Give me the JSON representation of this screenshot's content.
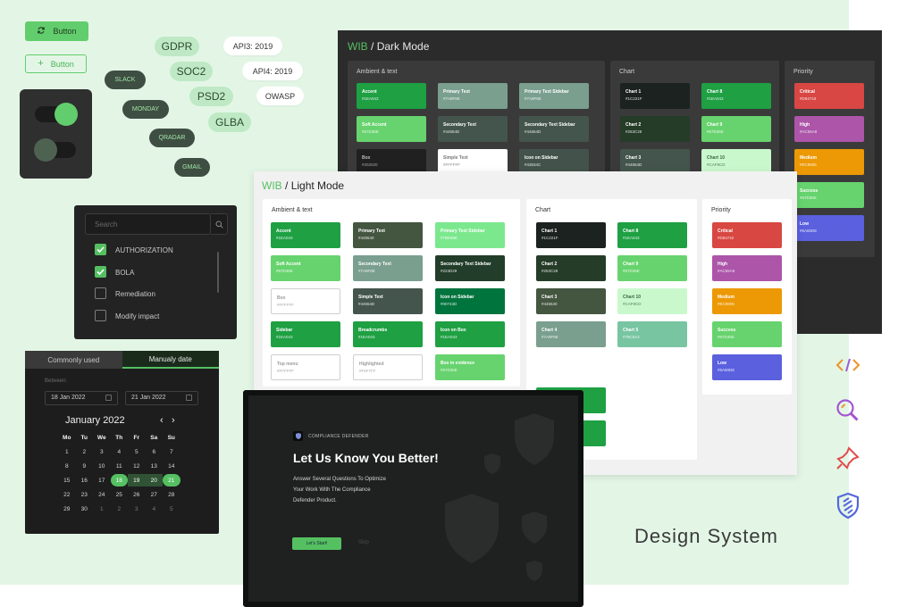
{
  "buttons": {
    "primary_label": "Button",
    "secondary_label": "Button"
  },
  "toggles": {
    "top_state": "on",
    "bottom_state": "off"
  },
  "tags": {
    "gdpr": "GDPR",
    "soc2": "SOC2",
    "psd2": "PSD2",
    "glba": "GLBA",
    "slack": "SLACK",
    "monday": "MONDAY",
    "qradar": "QRADAR",
    "gmail": "GMAIL",
    "api3": "API3: 2019",
    "api4": "API4: 2019",
    "owasp": "OWASP"
  },
  "filter": {
    "search_placeholder": "Search",
    "items": [
      {
        "label": "AUTHORIZATION",
        "checked": true
      },
      {
        "label": "BOLA",
        "checked": true
      },
      {
        "label": "Remediation",
        "checked": false
      },
      {
        "label": "Modify impact",
        "checked": false
      }
    ]
  },
  "date_picker": {
    "tab_common": "Commonly used",
    "tab_manual": "Manualy date",
    "between_label": "Between:",
    "start_date": "18 Jan 2022",
    "end_date": "21 Jan 2022",
    "month": "January 2022",
    "weekdays": [
      "Mo",
      "Tu",
      "We",
      "Th",
      "Fr",
      "Sa",
      "Su"
    ],
    "weeks": [
      [
        "1",
        "2",
        "3",
        "4",
        "5",
        "6",
        "7"
      ],
      [
        "8",
        "9",
        "10",
        "11",
        "12",
        "13",
        "14"
      ],
      [
        "15",
        "16",
        "17",
        "18",
        "19",
        "20",
        "21"
      ],
      [
        "22",
        "23",
        "24",
        "25",
        "26",
        "27",
        "28"
      ],
      [
        "29",
        "30",
        "1",
        "2",
        "3",
        "4",
        "5"
      ]
    ],
    "range_start": "18",
    "range_end": "21"
  },
  "dark_mode": {
    "brand": "WIB",
    "sep": " / ",
    "title": "Dark Mode",
    "ambient_header": "Ambient & text",
    "chart_header": "Chart",
    "priority_header": "Priority",
    "ambient": [
      {
        "name": "Accent",
        "hex": "#1EA043",
        "color": "#1ea043",
        "fg": "#ffffff"
      },
      {
        "name": "Primary Text",
        "hex": "#7A9F8E",
        "color": "#7a9f8e",
        "fg": "#ffffff"
      },
      {
        "name": "Primary Text Sidebar",
        "hex": "#7A9F8E",
        "color": "#7a9f8e",
        "fg": "#ffffff"
      },
      {
        "name": "Soft Accent",
        "hex": "#67D36E",
        "color": "#67d36e",
        "fg": "#ffffff"
      },
      {
        "name": "Secondary Text",
        "hex": "#44554D",
        "color": "#44554d",
        "fg": "#ffffff"
      },
      {
        "name": "Secondary Text Sidebar",
        "hex": "#44554D",
        "color": "#44554d",
        "fg": "#ffffff"
      },
      {
        "name": "Box",
        "hex": "#202020",
        "color": "#202020",
        "fg": "#bdbdbd"
      },
      {
        "name": "Simple Text",
        "hex": "#FFFFFF",
        "color": "#ffffff",
        "fg": "#777777"
      },
      {
        "name": "Icon on Sidebar",
        "hex": "#43534C",
        "color": "#43534c",
        "fg": "#ffffff"
      }
    ],
    "chart": [
      {
        "name": "Chart 1",
        "hex": "#1C221F",
        "color": "#1c221f",
        "fg": "#ffffff"
      },
      {
        "name": "Chart 8",
        "hex": "#1EA043",
        "color": "#1ea043",
        "fg": "#ffffff"
      },
      {
        "name": "Chart 2",
        "hex": "#253C28",
        "color": "#253c28",
        "fg": "#ffffff"
      },
      {
        "name": "Chart 9",
        "hex": "#67D36E",
        "color": "#67d36e",
        "fg": "#ffffff"
      },
      {
        "name": "Chart 3",
        "hex": "#44554D",
        "color": "#44554d",
        "fg": "#ffffff"
      },
      {
        "name": "Chart 10",
        "hex": "#CAF8CD",
        "color": "#caf8cd",
        "fg": "#3a6a40"
      }
    ],
    "priority": [
      {
        "name": "Critical",
        "hex": "#D84743",
        "color": "#d84743",
        "fg": "#ffffff"
      },
      {
        "name": "High",
        "hex": "#AC55A9",
        "color": "#ac55a9",
        "fg": "#ffffff"
      },
      {
        "name": "Medium",
        "hex": "#EC9905",
        "color": "#ec9905",
        "fg": "#ffffff"
      },
      {
        "name": "Success",
        "hex": "#67D36E",
        "color": "#67d36e",
        "fg": "#ffffff"
      },
      {
        "name": "Low",
        "hex": "#5A60DE",
        "color": "#5a60de",
        "fg": "#ffffff"
      }
    ]
  },
  "light_mode": {
    "brand": "WIB",
    "sep": " / ",
    "title": "Light Mode",
    "ambient_header": "Ambient & text",
    "chart_header": "Chart",
    "priority_header": "Priority",
    "ambient": [
      {
        "name": "Accent",
        "hex": "#1EA043",
        "color": "#1ea043",
        "fg": "#ffffff"
      },
      {
        "name": "Primary Text",
        "hex": "#445540",
        "color": "#445540",
        "fg": "#ffffff"
      },
      {
        "name": "Primary Text Sidebar",
        "hex": "#7BE88E",
        "color": "#7be88e",
        "fg": "#ffffff"
      },
      {
        "name": "Soft Accent",
        "hex": "#67D36E",
        "color": "#67d36e",
        "fg": "#ffffff"
      },
      {
        "name": "Secondary Text",
        "hex": "#7A9F8E",
        "color": "#7a9f8e",
        "fg": "#ffffff"
      },
      {
        "name": "Secondary Text Sidebar",
        "hex": "#223D29",
        "color": "#223d29",
        "fg": "#ffffff"
      },
      {
        "name": "Box",
        "hex": "#FFFFFF",
        "color": "#ffffff",
        "fg": "#9a9a9a",
        "border": "#cfcfcf"
      },
      {
        "name": "Simple Text",
        "hex": "#44554D",
        "color": "#44554d",
        "fg": "#ffffff"
      },
      {
        "name": "Icon on Sidebar",
        "hex": "#00743D",
        "color": "#00743d",
        "fg": "#ffffff"
      },
      {
        "name": "Sidebar",
        "hex": "#1EA043",
        "color": "#1ea043",
        "fg": "#ffffff"
      },
      {
        "name": "Breadcrumbs",
        "hex": "#1EA043",
        "color": "#1ea043",
        "fg": "#ffffff"
      },
      {
        "name": "Icon on Box",
        "hex": "#1EA043",
        "color": "#1ea043",
        "fg": "#ffffff"
      },
      {
        "name": "Top menu",
        "hex": "#FFFFFF",
        "color": "#ffffff",
        "fg": "#9a9a9a",
        "border": "#cfcfcf"
      },
      {
        "name": "Highlighted",
        "hex": "#F6F7FF",
        "color": "#ffffff",
        "fg": "#9a9a9a",
        "border": "#cfcfcf"
      },
      {
        "name": "Box in evidence",
        "hex": "#67D36E",
        "color": "#67d36e",
        "fg": "#ffffff"
      }
    ],
    "chart": [
      {
        "name": "Chart 1",
        "hex": "#1C221F",
        "color": "#1c221f",
        "fg": "#ffffff"
      },
      {
        "name": "Chart 8",
        "hex": "#1EA043",
        "color": "#1ea043",
        "fg": "#ffffff"
      },
      {
        "name": "Chart 2",
        "hex": "#253C28",
        "color": "#253c28",
        "fg": "#ffffff"
      },
      {
        "name": "Chart 9",
        "hex": "#67D36E",
        "color": "#67d36e",
        "fg": "#ffffff"
      },
      {
        "name": "Chart 3",
        "hex": "#445540",
        "color": "#445540",
        "fg": "#ffffff"
      },
      {
        "name": "Chart 10",
        "hex": "#CAF8CD",
        "color": "#caf8cd",
        "fg": "#3a6a40"
      },
      {
        "name": "Chart 4",
        "hex": "#7A9F8E",
        "color": "#7a9f8e",
        "fg": "#ffffff"
      },
      {
        "name": "Chart 5",
        "hex": "#78C5A2",
        "color": "#78c5a2",
        "fg": "#ffffff"
      }
    ],
    "priority": [
      {
        "name": "Critical",
        "hex": "#D84742",
        "color": "#d84742",
        "fg": "#ffffff"
      },
      {
        "name": "High",
        "hex": "#AC55A9",
        "color": "#ac55a9",
        "fg": "#ffffff"
      },
      {
        "name": "Medium",
        "hex": "#EC9905",
        "color": "#ec9905",
        "fg": "#ffffff"
      },
      {
        "name": "Success",
        "hex": "#67D36E",
        "color": "#67d36e",
        "fg": "#ffffff"
      },
      {
        "name": "Low",
        "hex": "#5A60DE",
        "color": "#5a60de",
        "fg": "#ffffff"
      }
    ]
  },
  "welcome": {
    "brand": "COMPLIANCE DEFENDER",
    "heading": "Let Us Know You Better!",
    "line1": "Answer Several Questions To Optimize",
    "line2": "Your Work With The Compliance",
    "line3": "Defender Product.",
    "start_button": "Let's Start!",
    "skip": "Skip"
  },
  "caption": "Design System",
  "side_icons": [
    "code-icon",
    "search-icon",
    "pin-icon",
    "shield-icon"
  ],
  "colors": {
    "accent": "#55c061",
    "background": "#e3f6e6"
  }
}
